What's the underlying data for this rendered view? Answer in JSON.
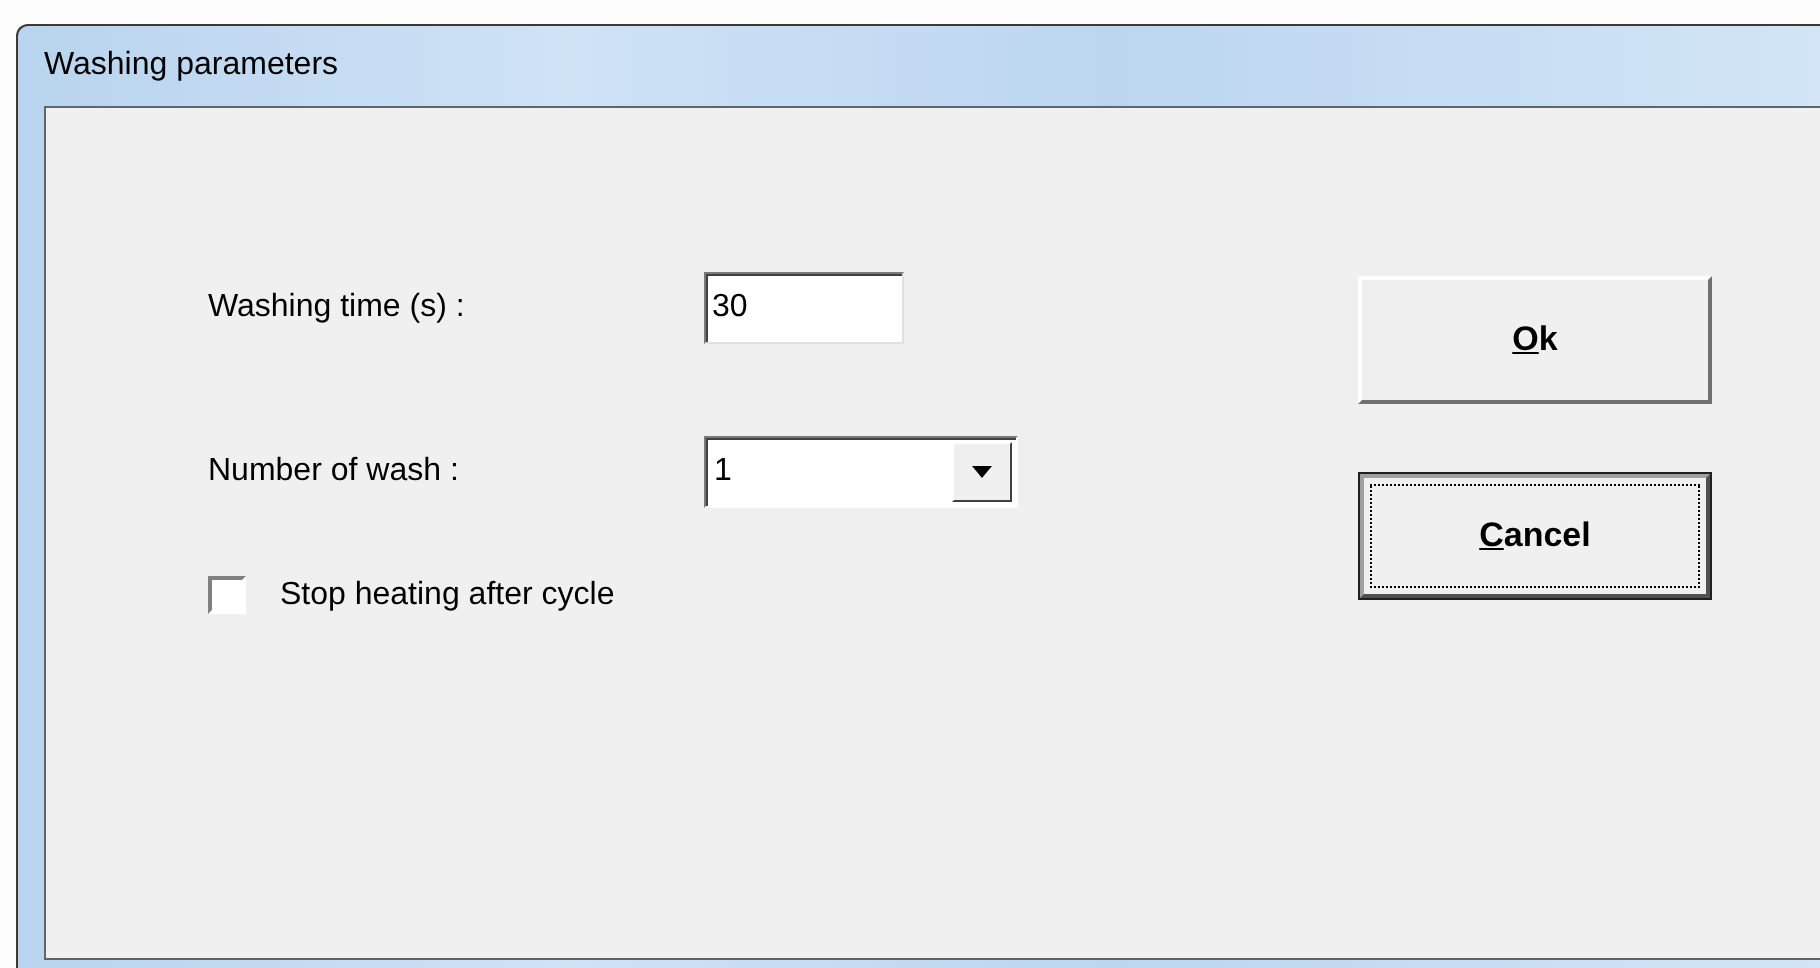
{
  "window": {
    "title": "Washing parameters"
  },
  "fields": [
    {
      "kind": "text",
      "label": "Washing time (s) :",
      "value": "30"
    },
    {
      "kind": "combo",
      "label": "Number of wash :",
      "value": "1"
    }
  ],
  "checkbox": {
    "label": "Stop heating after cycle",
    "checked": false
  },
  "buttons": [
    {
      "label": "Ok",
      "mnemonic_underlined": true,
      "focused": false
    },
    {
      "label": "Cancel",
      "mnemonic_underlined": true,
      "focused": true
    }
  ]
}
